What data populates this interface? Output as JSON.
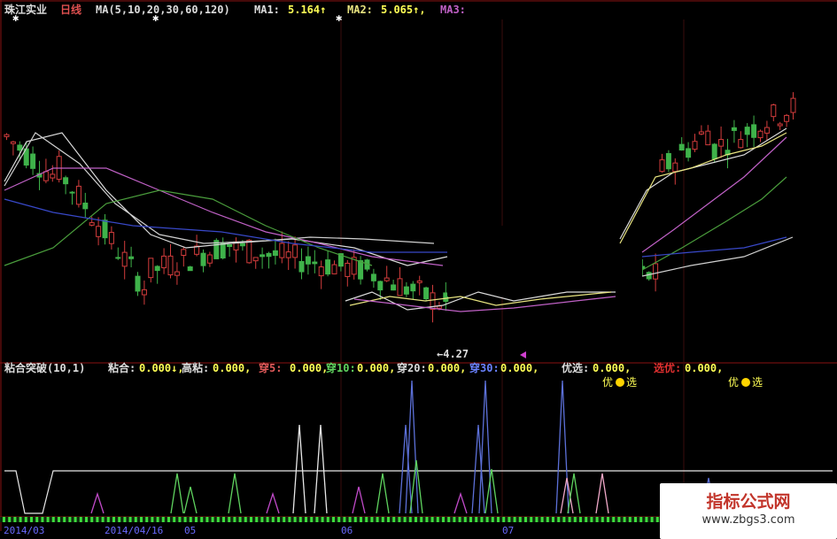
{
  "colors": {
    "bg": "#000000",
    "frame": "#8a1212",
    "up": "#d23c3c",
    "down": "#3fb24a",
    "ma5": "#dcdcdc",
    "ma10": "#e8e480",
    "ma20": "#c061c6",
    "ma30": "#4a9d3c",
    "ma60": "#3848c8",
    "ma120": "#d0d0d0",
    "label": "#dcdcdc",
    "value": "#ffff55",
    "white_line": "#e8e8e8",
    "green_spike": "#5fd35f",
    "magenta_spike": "#c04ac8",
    "blue_spike": "#5c70d8",
    "pink_spike": "#f0a8c8",
    "date_bar": "#3ddc3d",
    "date_text": "#6a6aff"
  },
  "price_panel": {
    "stock": "珠江实业",
    "period": "日线",
    "ma_params": "MA(5,10,20,30,60,120)",
    "ma1": {
      "label": "MA1:",
      "value": "5.164",
      "arrow": "↑"
    },
    "ma2": {
      "label": "MA2:",
      "value": "5.065",
      "arrow": "↑"
    },
    "ma3": {
      "label": "MA3:"
    },
    "low_marker": "←4.27"
  },
  "indicator_panel": {
    "name": "粘合突破(10,1)",
    "items": [
      {
        "label": "粘合:",
        "value": "0.000↓,",
        "label_color": "#dcdcdc"
      },
      {
        "label": "高粘:",
        "value": "0.000,",
        "label_color": "#dcdcdc"
      },
      {
        "label": "穿5:",
        "value": "0.000,",
        "label_color": "#e05a5a"
      },
      {
        "label": "穿10:",
        "value": "0.000,",
        "label_color": "#5fd35f"
      },
      {
        "label": "穿20:",
        "value": "0.000,",
        "label_color": "#dcdcdc"
      },
      {
        "label": "穿30:",
        "value": "0.000,",
        "label_color": "#6a82ff"
      },
      {
        "label": "优选:",
        "value": "0.000,",
        "label_color": "#dcdcdc"
      },
      {
        "label": "选优:",
        "value": "0.000,",
        "label_color": "#e03030"
      }
    ],
    "signal_left": "优",
    "signal_right": "选"
  },
  "date_axis": {
    "dates": [
      "2014/03",
      "2014/04/16",
      "05",
      "06",
      "07"
    ]
  },
  "watermark": {
    "title": "指标公式网",
    "url": "www.zbgs3.com"
  }
}
